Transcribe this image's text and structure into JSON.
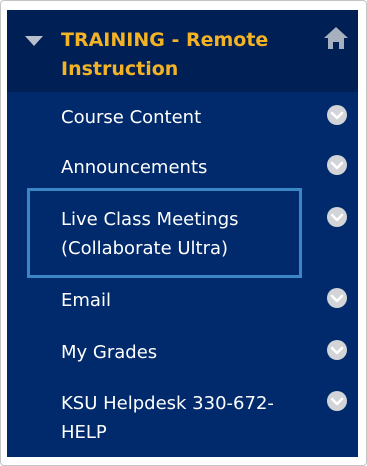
{
  "course": {
    "title_line1": "TRAINING - Remote",
    "title_line2": "Instruction",
    "collapse_icon": "triangle-down-icon",
    "home_icon": "home-icon"
  },
  "menu": [
    {
      "line1": "Course Content",
      "line2": "",
      "icon": "chevron-down-circle-icon"
    },
    {
      "line1": "Announcements",
      "line2": "",
      "icon": "chevron-down-circle-icon"
    },
    {
      "line1": "Live Class Meetings",
      "line2": "(Collaborate Ultra)",
      "icon": "chevron-down-circle-icon"
    },
    {
      "line1": "Email",
      "line2": "",
      "icon": "chevron-down-circle-icon"
    },
    {
      "line1": "My Grades",
      "line2": "",
      "icon": "chevron-down-circle-icon"
    },
    {
      "line1": "KSU Helpdesk 330-672-",
      "line2": "HELP",
      "icon": "chevron-down-circle-icon"
    }
  ],
  "colors": {
    "panel_bg": "#002a6b",
    "header_bg": "#001f55",
    "title_gold": "#f3b324",
    "highlight_border": "#3b86c6"
  }
}
